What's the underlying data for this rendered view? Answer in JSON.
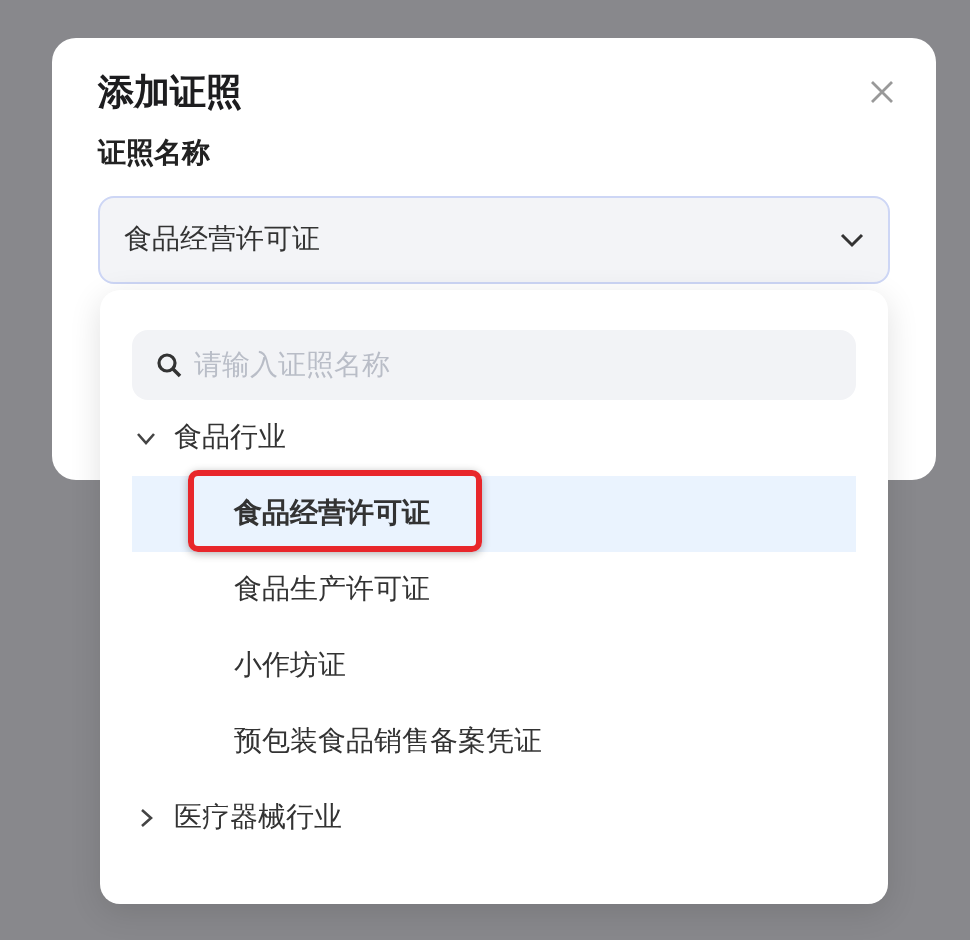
{
  "dialog": {
    "title": "添加证照",
    "field_label": "证照名称",
    "value": "食品经营许可证"
  },
  "dropdown": {
    "search": {
      "placeholder": "请输入证照名称"
    },
    "tree": [
      {
        "label": "食品行业",
        "expanded": true,
        "children": [
          {
            "label": "食品经营许可证",
            "selected": true,
            "highlighted": true
          },
          {
            "label": "食品生产许可证",
            "selected": false,
            "highlighted": false
          },
          {
            "label": "小作坊证",
            "selected": false,
            "highlighted": false
          },
          {
            "label": "预包装食品销售备案凭证",
            "selected": false,
            "highlighted": false
          }
        ]
      },
      {
        "label": "医疗器械行业",
        "expanded": false
      }
    ]
  }
}
